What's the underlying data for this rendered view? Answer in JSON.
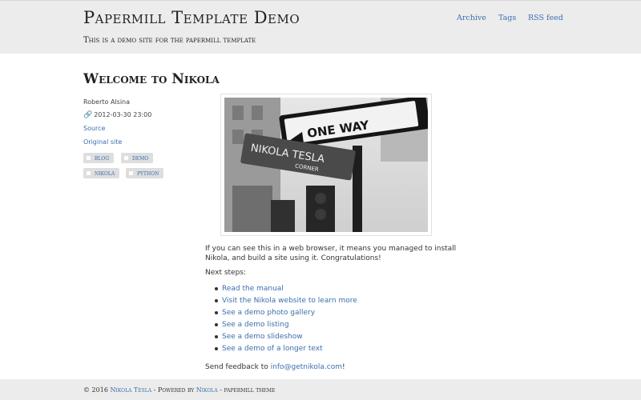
{
  "header": {
    "site_title": "Papermill Template Demo",
    "site_subtitle": "This is a demo site for the papermill template",
    "nav": [
      "Archive",
      "Tags",
      "RSS feed"
    ]
  },
  "post": {
    "title": "Welcome to Nikola",
    "author": "Roberto Alsina",
    "date": "2012-03-30 23:00",
    "source_label": "Source",
    "original_label": "Original site",
    "tags": [
      "blog",
      "demo",
      "nikola",
      "python"
    ],
    "photo_sign_one_way": "ONE WAY",
    "photo_sign_street": "NIKOLA TESLA",
    "photo_sign_corner": "CORNER",
    "paragraph1": "If you can see this in a web browser, it means you managed to install Nikola, and build a site using it. Congratulations!",
    "next_steps_label": "Next steps:",
    "steps": [
      "Read the manual",
      "Visit the Nikola website to learn more",
      "See a demo photo gallery",
      "See a demo listing",
      "See a demo slideshow",
      "See a demo of a longer text"
    ],
    "feedback_prefix": "Send feedback to ",
    "feedback_email": "info@getnikola.com",
    "feedback_suffix": "!"
  },
  "footer": {
    "copyright": "© 2016 ",
    "author_link": "Nikola Tesla",
    "powered_text": " - Powered by ",
    "nikola_link": "Nikola",
    "theme_text": " - papermill theme"
  },
  "colors": {
    "link": "#3b6fae",
    "header_bg": "#ececec",
    "tag_bg": "#dedede"
  }
}
